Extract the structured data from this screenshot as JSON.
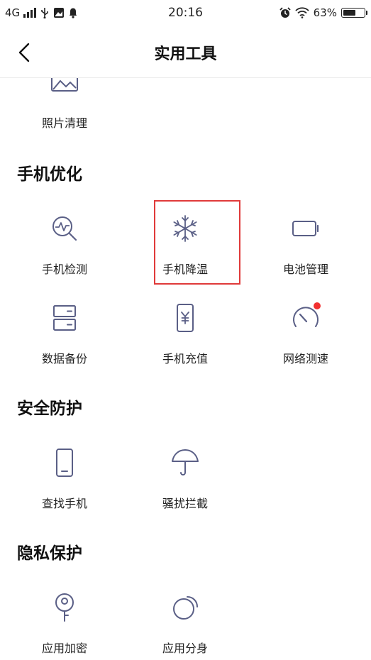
{
  "status_bar": {
    "network": "4G",
    "time": "20:16",
    "battery": "63%",
    "battery_level": 0.63
  },
  "nav": {
    "title": "实用工具"
  },
  "top_partial_item": {
    "label": "照片清理",
    "icon": "image-icon"
  },
  "sections": [
    {
      "title": "手机优化",
      "items": [
        {
          "label": "手机检测",
          "icon": "magnifier-pulse-icon"
        },
        {
          "label": "手机降温",
          "icon": "snowflake-icon",
          "highlighted": true
        },
        {
          "label": "电池管理",
          "icon": "battery-icon"
        },
        {
          "label": "数据备份",
          "icon": "storage-icon"
        },
        {
          "label": "手机充值",
          "icon": "yuan-phone-icon"
        },
        {
          "label": "网络测速",
          "icon": "speedometer-icon",
          "badge": true
        }
      ]
    },
    {
      "title": "安全防护",
      "items": [
        {
          "label": "查找手机",
          "icon": "phone-icon"
        },
        {
          "label": "骚扰拦截",
          "icon": "umbrella-icon"
        }
      ]
    },
    {
      "title": "隐私保护",
      "items": [
        {
          "label": "应用加密",
          "icon": "key-icon"
        },
        {
          "label": "应用分身",
          "icon": "clone-circles-icon"
        }
      ]
    }
  ],
  "colors": {
    "icon_stroke": "#5a5f86",
    "highlight": "#e03a3a",
    "badge": "#f23030"
  }
}
